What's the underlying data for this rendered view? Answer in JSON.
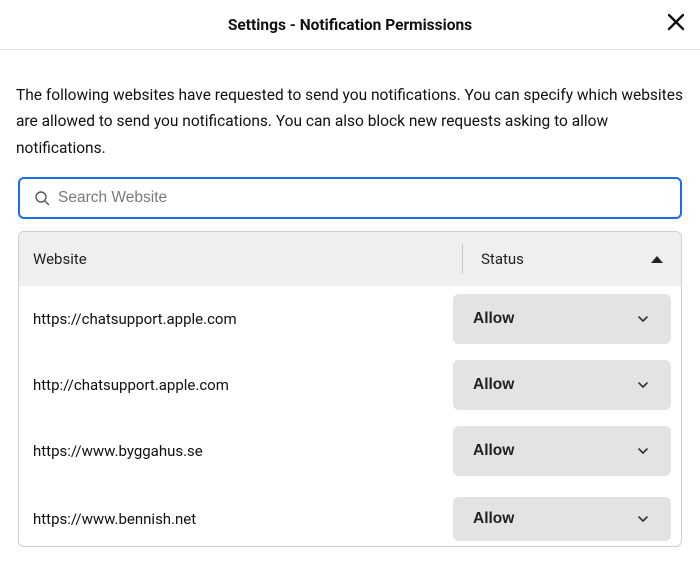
{
  "header": {
    "title": "Settings - Notification Permissions"
  },
  "description": "The following websites have requested to send you notifications. You can specify which websites are allowed to send you notifications. You can also block new requests asking to allow notifications.",
  "search": {
    "placeholder": "Search Website",
    "value": ""
  },
  "table": {
    "headers": {
      "website": "Website",
      "status": "Status"
    },
    "rows": [
      {
        "site": "https://chatsupport.apple.com",
        "status": "Allow"
      },
      {
        "site": "http://chatsupport.apple.com",
        "status": "Allow"
      },
      {
        "site": "https://www.byggahus.se",
        "status": "Allow"
      },
      {
        "site": "https://www.bennish.net",
        "status": "Allow"
      }
    ]
  }
}
